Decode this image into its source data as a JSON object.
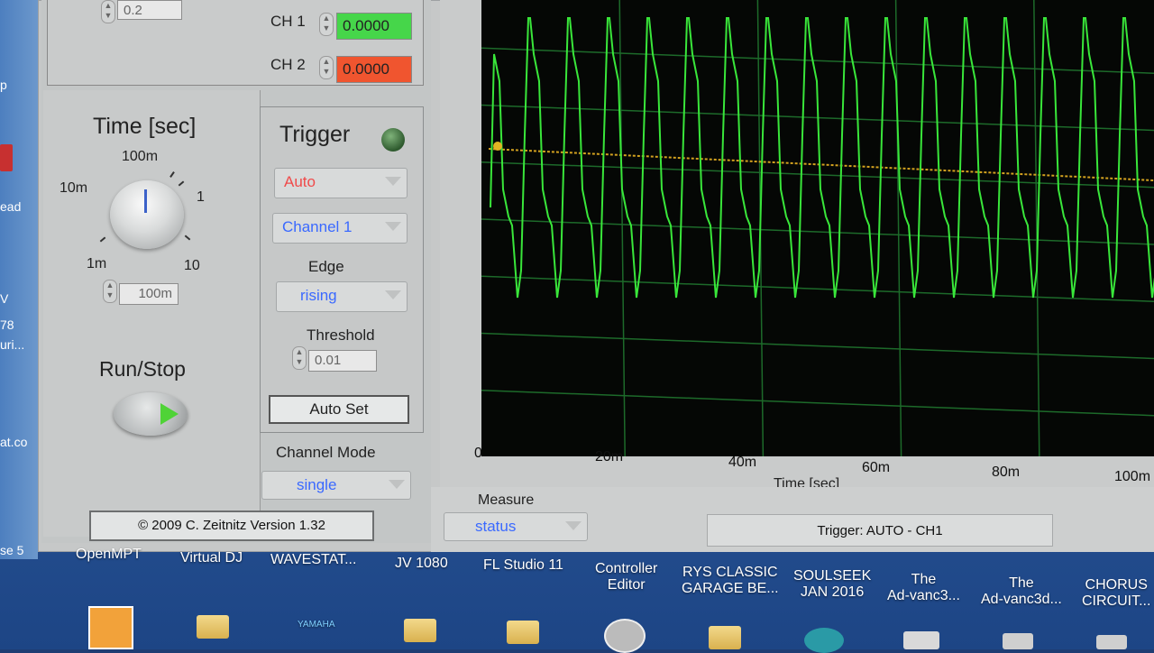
{
  "desktop": {
    "left_texts": [
      "p",
      "ead",
      "V",
      "78",
      "uri...",
      "at.co",
      "se 5"
    ],
    "taskbar_items": [
      {
        "label": "OpenMPT"
      },
      {
        "label": "Virtual DJ"
      },
      {
        "label": "WAVESTAT..."
      },
      {
        "label": "JV 1080"
      },
      {
        "label": "FL Studio 11"
      },
      {
        "label": "Controller\nEditor"
      },
      {
        "label": "RYS CLASSIC\nGARAGE BE..."
      },
      {
        "label": "SOULSEEK\nJAN 2016"
      },
      {
        "label": "The\nAd-vanc3..."
      },
      {
        "label": "The\nAd-vanc3d..."
      },
      {
        "label": "CHORUS\nCIRCUIT..."
      }
    ],
    "icon_text": "YAMAHA"
  },
  "scope": {
    "top_value": "0.2",
    "ch1_label": "CH 1",
    "ch1_value": "0.0000",
    "ch1_color": "#46d64a",
    "ch2_label": "CH 2",
    "ch2_value": "0.0000",
    "ch2_color": "#f0552f",
    "time_title": "Time [sec]",
    "knob_labels": {
      "l100m": "100m",
      "l10m": "10m",
      "l1": "1",
      "l1m": "1m",
      "l10": "10"
    },
    "time_value": "100m",
    "run_stop_label": "Run/Stop",
    "trigger": {
      "title": "Trigger",
      "mode": "Auto",
      "mode_color": "#f04a4a",
      "source": "Channel 1",
      "source_color": "#3a69ff",
      "edge_label": "Edge",
      "edge_value": "rising",
      "edge_color": "#3a69ff",
      "threshold_label": "Threshold",
      "threshold_value": "0.01",
      "auto_set": "Auto Set"
    },
    "channel_mode_label": "Channel Mode",
    "channel_mode_value": "single",
    "copyright": "© 2009  C. Zeitnitz Version 1.32",
    "graph": {
      "x_ticks": [
        "0",
        "20m",
        "40m",
        "60m",
        "80m",
        "100m"
      ],
      "x_label": "Time [sec]",
      "trace_color": "#39e63a",
      "trigger_line_color": "#d3a21f"
    },
    "measure_label": "Measure",
    "measure_value": "status",
    "status_text": "Trigger: AUTO - CH1"
  }
}
